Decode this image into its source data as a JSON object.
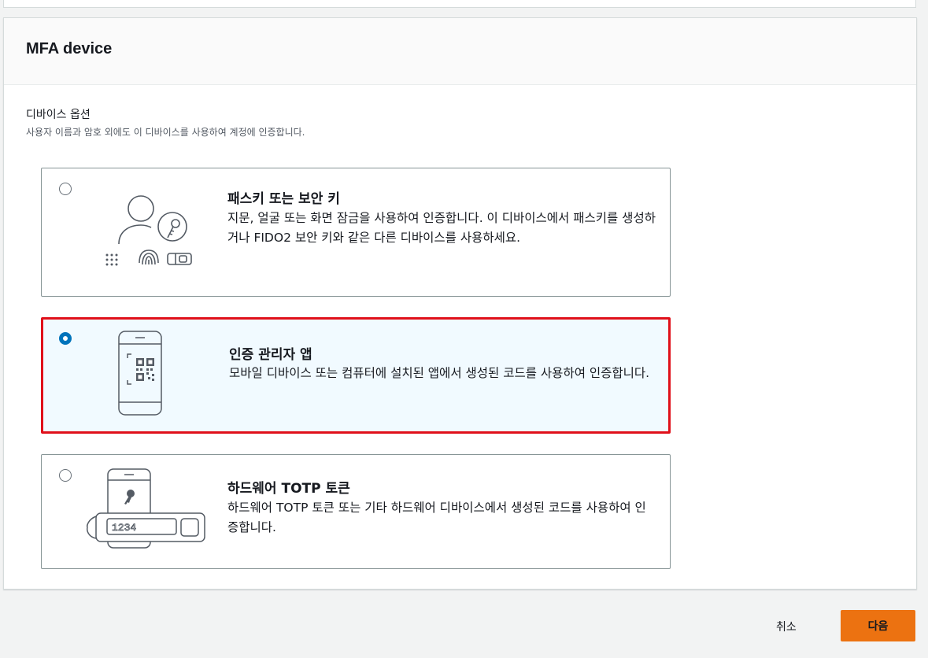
{
  "panel": {
    "title": "MFA device"
  },
  "device_options": {
    "label": "디바이스 옵션",
    "description": "사용자 이름과 암호 외에도 이 디바이스를 사용하여 계정에 인증합니다."
  },
  "options": [
    {
      "title": "패스키 또는 보안 키",
      "description": "지문, 얼굴 또는 화면 잠금을 사용하여 인증합니다. 이 디바이스에서 패스키를 생성하거나 FIDO2 보안 키와 같은 다른 디바이스를 사용하세요.",
      "selected": false,
      "icon": "passkey-security-key-icon"
    },
    {
      "title": "인증 관리자 앱",
      "description": "모바일 디바이스 또는 컴퓨터에 설치된 앱에서 생성된 코드를 사용하여 인증합니다.",
      "selected": true,
      "icon": "authenticator-app-icon"
    },
    {
      "title": "하드웨어 TOTP 토큰",
      "description": "하드웨어 TOTP 토큰 또는 기타 하드웨어 디바이스에서 생성된 코드를 사용하여 인증합니다.",
      "selected": false,
      "icon": "hardware-token-icon",
      "token_display": "1234"
    }
  ],
  "footer": {
    "cancel_label": "취소",
    "next_label": "다음"
  },
  "colors": {
    "selected_radio": "#0073bb",
    "selected_border": "#e0101a",
    "selected_bg": "#f1faff",
    "primary_button": "#ec7211"
  }
}
